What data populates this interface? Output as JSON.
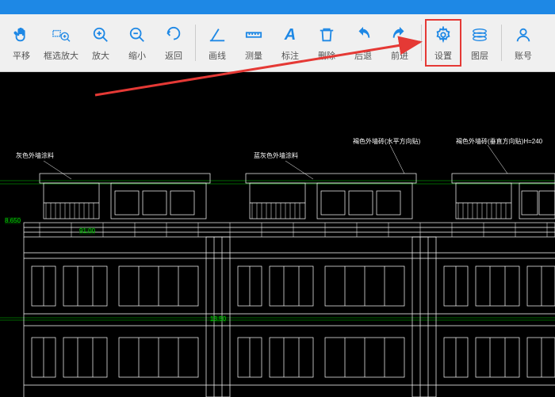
{
  "toolbar": {
    "items": [
      {
        "label": "平移",
        "icon": "pan"
      },
      {
        "label": "框选放大",
        "icon": "zoom-window"
      },
      {
        "label": "放大",
        "icon": "zoom-in"
      },
      {
        "label": "缩小",
        "icon": "zoom-out"
      },
      {
        "label": "返回",
        "icon": "return"
      },
      {
        "label": "画线",
        "icon": "line"
      },
      {
        "label": "测量",
        "icon": "measure"
      },
      {
        "label": "标注",
        "icon": "annotate"
      },
      {
        "label": "删除",
        "icon": "delete"
      },
      {
        "label": "后退",
        "icon": "undo"
      },
      {
        "label": "前进",
        "icon": "redo"
      },
      {
        "label": "设置",
        "icon": "settings"
      },
      {
        "label": "图层",
        "icon": "layers"
      },
      {
        "label": "账号",
        "icon": "account"
      }
    ]
  },
  "annotations": {
    "a1": "灰色外墙涂料",
    "a2": "蓝灰色外墙涂料",
    "a3": "褐色外墙砖(水平方向贴)",
    "a4": "褐色外墙砖(垂直方向贴)H=240"
  },
  "dimensions": {
    "d1": "8.650",
    "d2": "91.00",
    "d3": "13.50"
  },
  "colors": {
    "accent": "#1e88e5",
    "highlight": "#e53935",
    "cad_line": "#ffffff",
    "cad_green": "#00cc00"
  }
}
